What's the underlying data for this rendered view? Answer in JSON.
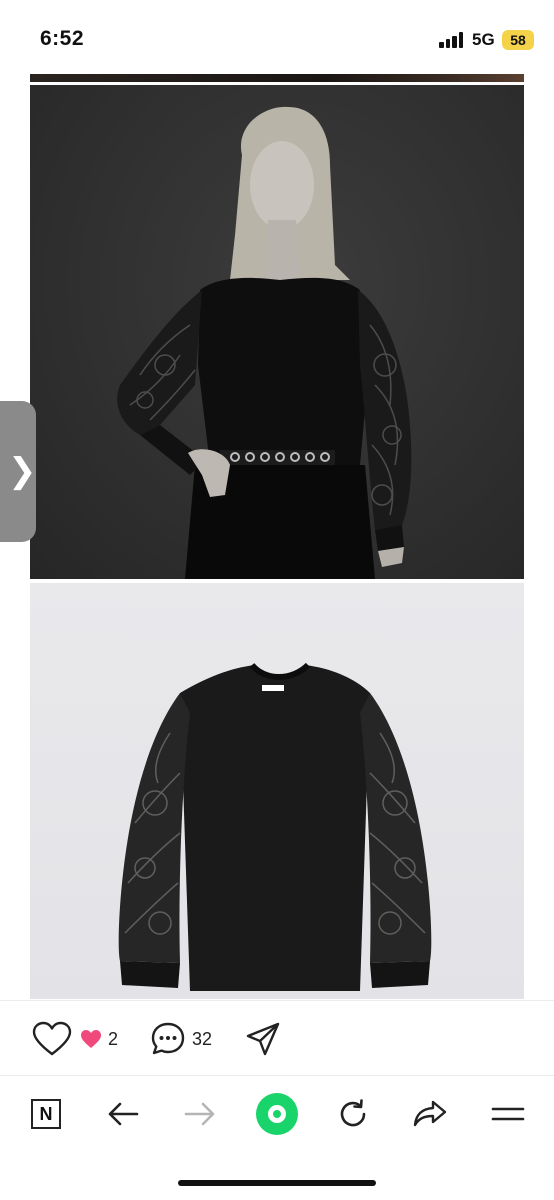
{
  "status_bar": {
    "time": "6:52",
    "network": "5G",
    "battery": "58"
  },
  "content": {
    "side_handle_chevron": "❯",
    "images": [
      {
        "name": "model-wearing-lace-sleeve-top"
      },
      {
        "name": "black-top-lace-sleeves-product"
      }
    ],
    "product_label_color": "#ffffff"
  },
  "reactions": {
    "like_count": "2",
    "comment_count": "32"
  },
  "browser_bar": {
    "home_label": "N",
    "accent_color": "#19d36b"
  }
}
